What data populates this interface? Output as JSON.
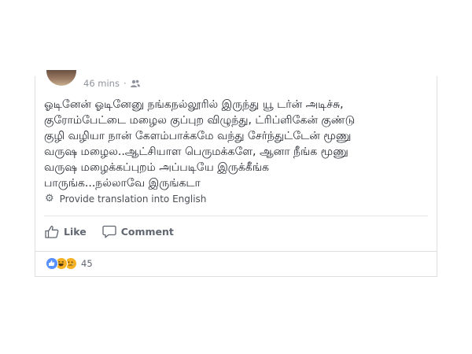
{
  "post": {
    "time": "46 mins",
    "privacy_icon": "friends-icon",
    "lines": [
      "ஓடினேன் ஓடினேனு நங்கநல்லூரில் இருந்து யூ டர்ன் அடிச்சு,",
      "குரோம்பேட்டை மழைல குப்புற விழுந்து, ட்ரிப்ளிகேன் குண்டு",
      "குழி வழியா நான் கேளம்பாக்கமே வந்து சேர்ந்துட்டேன் மூணு",
      "வருஷ மழைல..ஆட்சியாள பெருமக்களே, ஆனா நீங்க மூணு",
      "வருஷ மழைக்கப்புறம் அப்படியே இருக்கீங்க",
      "பாருங்க...நல்லாவே இருங்கடா"
    ],
    "translate_label": "Provide translation into English"
  },
  "actions": {
    "like_label": "Like",
    "comment_label": "Comment"
  },
  "reactions": {
    "icons": [
      "like-reaction-icon",
      "haha-reaction-icon",
      "sad-reaction-icon"
    ],
    "count": "45"
  },
  "colors": {
    "meta_text": "#90949c",
    "body_text": "#1d2129",
    "action_text": "#616770",
    "like_blue": "#5890ff",
    "emoji_yellow": "#f7b125"
  }
}
